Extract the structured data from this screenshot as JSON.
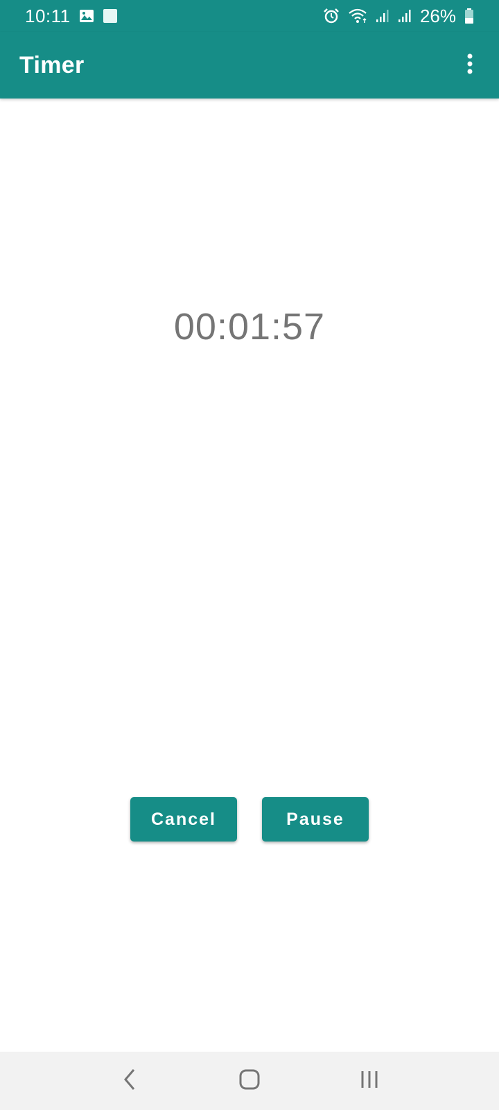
{
  "status_bar": {
    "time": "10:11",
    "battery_percent": "26%",
    "icons": [
      "image-icon",
      "square-notification-icon",
      "alarm-icon",
      "wifi-icon",
      "signal-icon",
      "signal-icon",
      "battery-icon"
    ],
    "battery_level": 0.26
  },
  "app_bar": {
    "title": "Timer",
    "menu_icon": "more-vert-icon"
  },
  "timer": {
    "remaining": "00:01:57"
  },
  "buttons": {
    "cancel_label": "Cancel",
    "pause_label": "Pause"
  },
  "nav_bar": {
    "icons": [
      "back-icon",
      "home-icon",
      "recents-icon"
    ]
  },
  "colors": {
    "primary": "#168d87",
    "timer_text": "#757575",
    "nav_background": "#f2f2f2"
  }
}
